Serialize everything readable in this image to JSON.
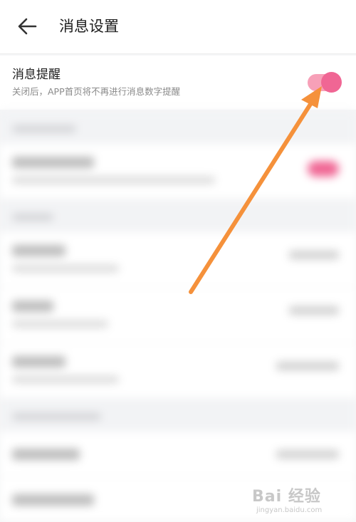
{
  "header": {
    "title": "消息设置",
    "back_icon": "arrow-left-icon"
  },
  "main_setting": {
    "title": "消息提醒",
    "subtitle": "关闭后，APP首页将不再进行消息数字提醒",
    "toggle_on": true,
    "toggle_color": "#f06694"
  },
  "annotation": {
    "arrow_color": "#f5913b"
  },
  "watermark": {
    "logo": "Bai 经验",
    "url": "jingyan.baidu.com"
  }
}
